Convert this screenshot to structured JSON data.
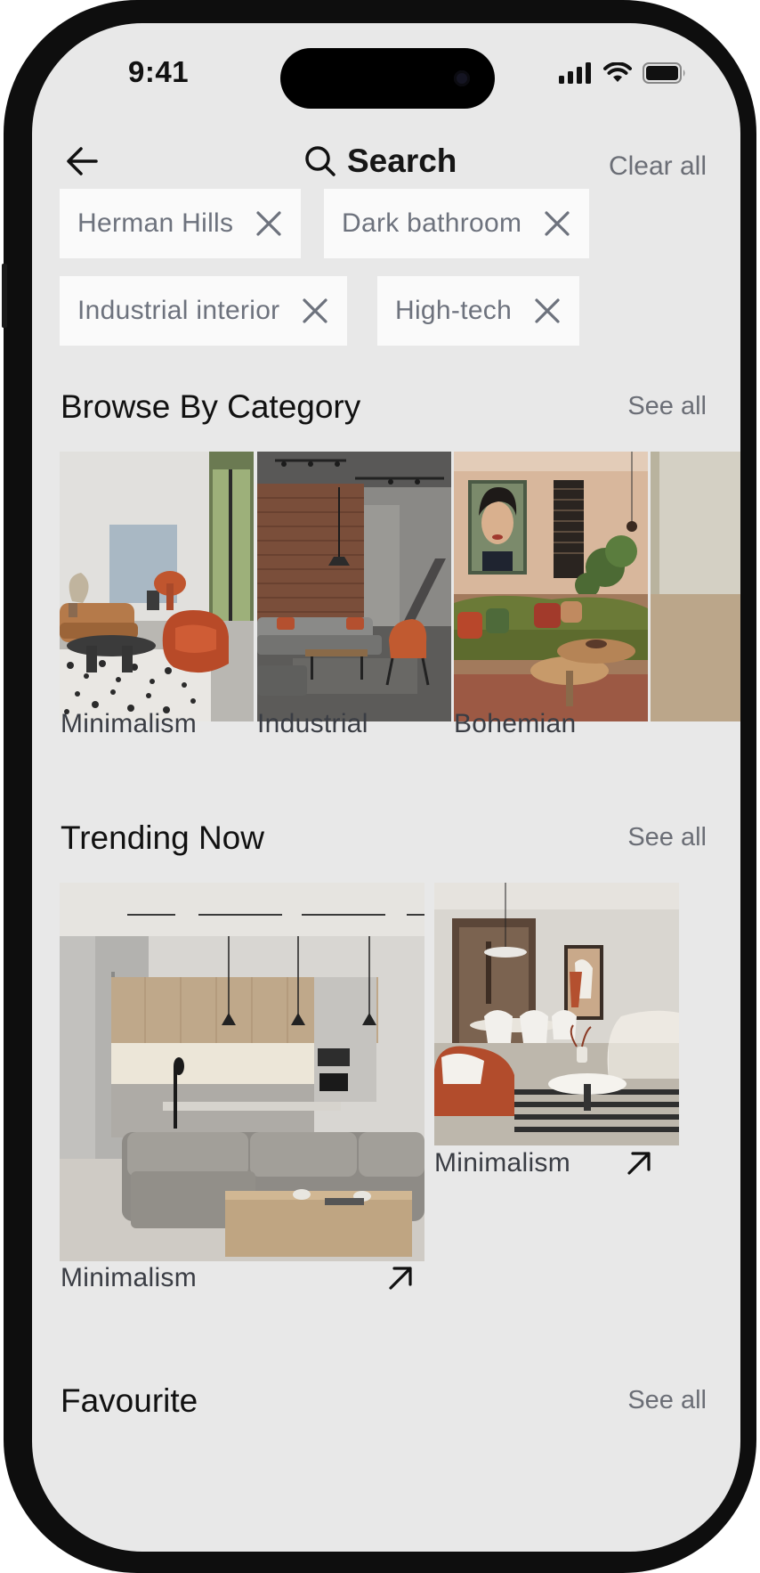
{
  "status_bar": {
    "time": "9:41"
  },
  "header": {
    "title": "Search",
    "clear_label": "Clear all"
  },
  "chips": [
    {
      "label": "Herman Hills"
    },
    {
      "label": "Dark bathroom"
    },
    {
      "label": "Industrial interior"
    },
    {
      "label": "High-tech"
    }
  ],
  "categories": {
    "title": "Browse By Category",
    "see_all": "See all",
    "items": [
      {
        "label": "Minimalism"
      },
      {
        "label": "Industrial"
      },
      {
        "label": "Bohemian"
      }
    ]
  },
  "trending": {
    "title": "Trending Now",
    "see_all": "See all",
    "items": [
      {
        "label": "Minimalism"
      },
      {
        "label": "Minimalism"
      }
    ]
  },
  "favourite": {
    "title": "Favourite",
    "see_all": "See all"
  },
  "icons": {
    "back": "arrow-left-icon",
    "search": "search-icon",
    "remove": "close-icon",
    "open": "arrow-up-right-icon",
    "signal": "cellular-signal-icon",
    "wifi": "wifi-icon",
    "battery": "battery-icon"
  },
  "colors": {
    "screen_bg": "#e8e8e8",
    "chip_bg": "#fafafa",
    "muted_text": "#6b6e76"
  }
}
